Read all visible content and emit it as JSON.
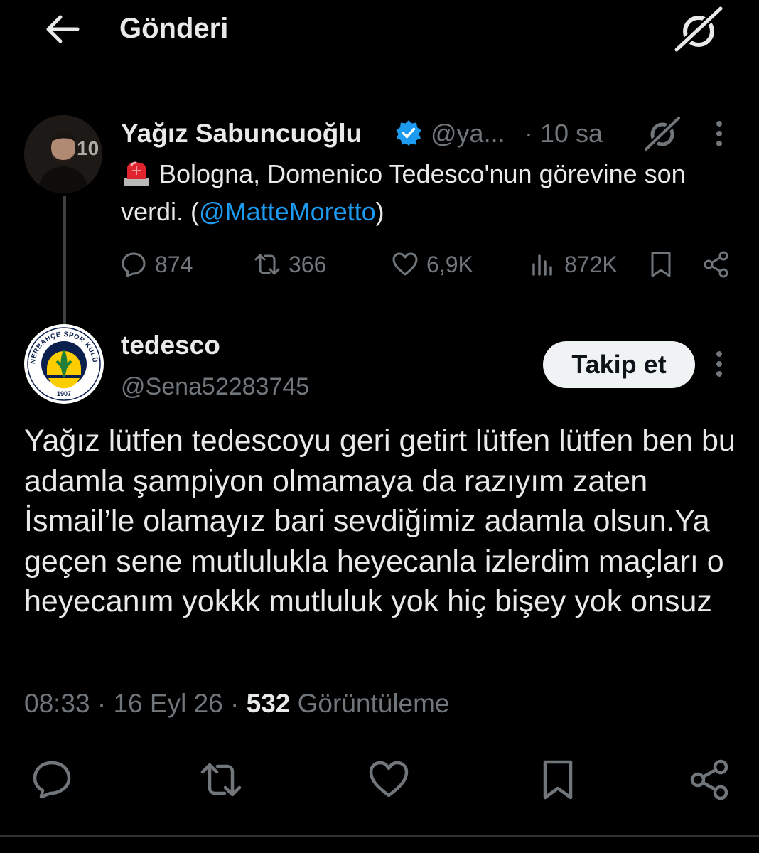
{
  "header": {
    "title": "Gönderi"
  },
  "parent_post": {
    "author_name": "Yağız Sabuncuoğlu",
    "handle": "@ya...",
    "time": "· 10 sa",
    "text": "Bologna, Domenico Tedesco'nun görevine son verdi. (",
    "mention": "@MatteMoretto",
    "text_end": ")",
    "stats": {
      "replies": "874",
      "reposts": "366",
      "likes": "6,9K",
      "views": "872K"
    }
  },
  "reply_post": {
    "author_name": "tedesco",
    "handle": "@Sena52283745",
    "follow_label": "Takip et",
    "text": "Yağız lütfen tedescoyu geri getirt lütfen lütfen ben bu adamla şampiyon olmamaya da razıyım zaten İsmail’le olamayız bari sevdiğimiz adamla olsun.Ya geçen sene mutlulukla heyecanla izlerdim maçları o heyecanım yokkk mutluluk yok hiç bişey yok onsuz",
    "meta": {
      "time": "08:33 · 16 Eyl 26 · ",
      "views_count": "532",
      "views_label": " Görüntüleme"
    },
    "avatar_text": {
      "top": "FENERBAHÇE SPOR KULÜBÜ",
      "year": "1907"
    }
  },
  "colors": {
    "accent": "#1d9bf0",
    "muted": "#71767b",
    "text": "#e7e9ea",
    "background": "#000000"
  }
}
